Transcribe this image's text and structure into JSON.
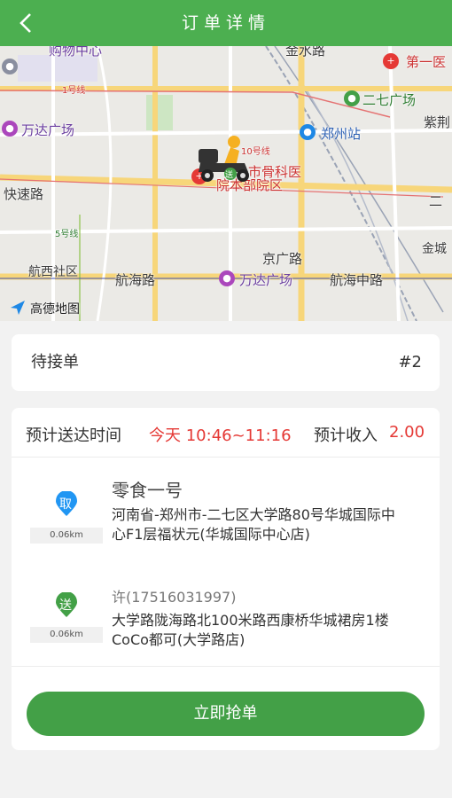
{
  "header": {
    "title": "订单详情",
    "back_icon": "chevron-left-icon"
  },
  "map": {
    "attribution": "高德地图",
    "labels": {
      "shopping_center": "购物中心",
      "jinshui_road": "金水路",
      "first_hospital": "第一医",
      "erqi_square": "二七广场",
      "wanda_left": "万达广场",
      "zhengzhou_station": "郑州站",
      "purple_mountain": "紫荆",
      "line10": "10号线",
      "hospital_top": "市骨科医",
      "hospital_bottom": "院本部院区",
      "expressway": "快速路",
      "line5": "5号线",
      "er": "二",
      "jingguang_road": "京广路",
      "jin": "金城",
      "hangxi_community": "航西社区",
      "hanghai_road": "航海路",
      "wanda_bottom": "万达广场",
      "hanghai_middle_road": "航海中路",
      "line1": "1号线",
      "rider_badge": "送"
    }
  },
  "status": {
    "text": "待接单",
    "order_no": "#2"
  },
  "order": {
    "eta_label": "预计送达时间",
    "eta_value": "今天 10:46~11:16",
    "income_label": "预计收入",
    "income_value": "2.00",
    "pickup": {
      "marker_text": "取",
      "distance": "0.06km",
      "shop_name": "零食一号",
      "address": "河南省-郑州市-二七区大学路80号华城国际中心F1层福状元(华城国际中心店)"
    },
    "delivery": {
      "marker_text": "送",
      "distance": "0.06km",
      "contact": "许(17516031997)",
      "address": "大学路陇海路北100米路西康桥华城裙房1楼CoCo都可(大学路店)"
    },
    "action_label": "立即抢单"
  },
  "colors": {
    "primary": "#4caf50",
    "button": "#43a047",
    "accent_red": "#e53935"
  }
}
